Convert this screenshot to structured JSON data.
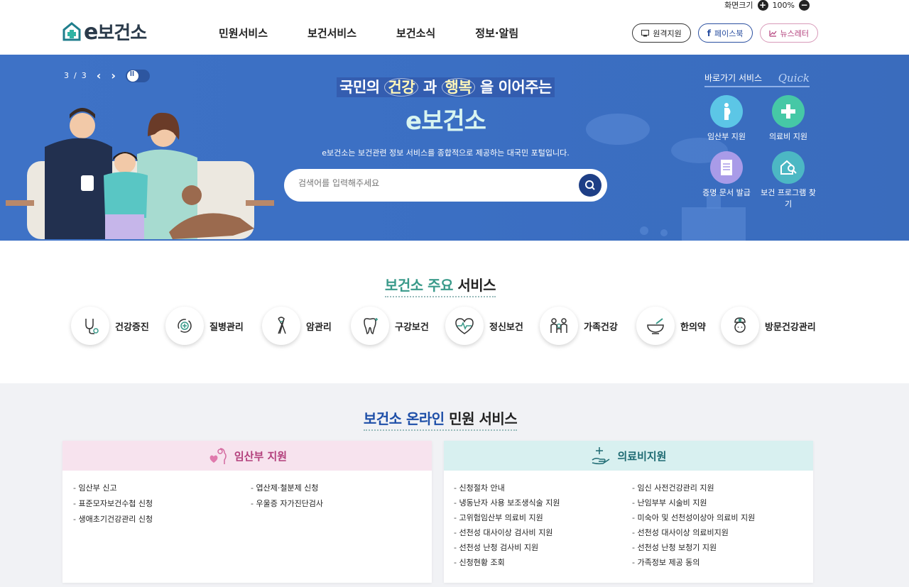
{
  "util": {
    "label": "화면크기",
    "plus": "+",
    "zoom": "100%",
    "minus": "−"
  },
  "header": {
    "logo_e": "e",
    "logo_text": "보건소",
    "nav": [
      "민원서비스",
      "보건서비스",
      "보건소식",
      "정보·알림"
    ],
    "buttons": {
      "remote": "원격지원",
      "facebook": "페이스북",
      "newsletter": "뉴스레터"
    }
  },
  "hero": {
    "page_current": "3",
    "page_sep": "/",
    "page_total": "3",
    "title_1": "국민의 ",
    "title_hl1": "건강",
    "title_2": " 과 ",
    "title_hl2": "행복",
    "title_3": " 을 이어주는",
    "brand": "e보건소",
    "desc": "e보건소는 보건관련 정보 서비스를 종합적으로 제공하는 대국민 포털입니다.",
    "search_placeholder": "검색어를 입력해주세요",
    "quick_label": "바로가기 서비스",
    "quick_script": "Quick",
    "quick_items": [
      "임산부 지원",
      "의료비 지원",
      "증명 문서 발급",
      "보건 프로그램 찾기"
    ]
  },
  "main_services": {
    "title_a": "보건소 주요",
    "title_b": " 서비스",
    "items": [
      "건강증진",
      "질병관리",
      "암관리",
      "구강보건",
      "정신보건",
      "가족건강",
      "한의약",
      "방문건강관리"
    ]
  },
  "online": {
    "title_a": "보건소 온라인",
    "title_b": " 민원 서비스",
    "pregnant": {
      "title": "임산부 지원",
      "col1": [
        "임산부 신고",
        "표준모자보건수첩 신청",
        "생애초기건강관리 신청"
      ],
      "col2": [
        "엽산제·철분제 신청",
        "우울증 자가진단검사"
      ]
    },
    "medical": {
      "title": "의료비지원",
      "col1": [
        "신청절차 안내",
        "냉동난자 사용 보조생식술 지원",
        "고위험임산부 의료비 지원",
        "선천성 대사이상 검사비 지원",
        "선천성 난청 검사비 지원",
        "신청현황 조회"
      ],
      "col2": [
        "임신 사전건강관리 지원",
        "난임부부 시술비 지원",
        "미숙아 및 선천성이상아 의료비 지원",
        "선천성 대사이상 의료비지원",
        "선천성 난청 보청기 지원",
        "가족정보 제공 동의"
      ]
    }
  },
  "colors": {
    "hero_bg": "#3e72c6",
    "accent_teal": "#3a9a8a",
    "accent_blue": "#1e4fa8",
    "pink": "#b3407c"
  }
}
